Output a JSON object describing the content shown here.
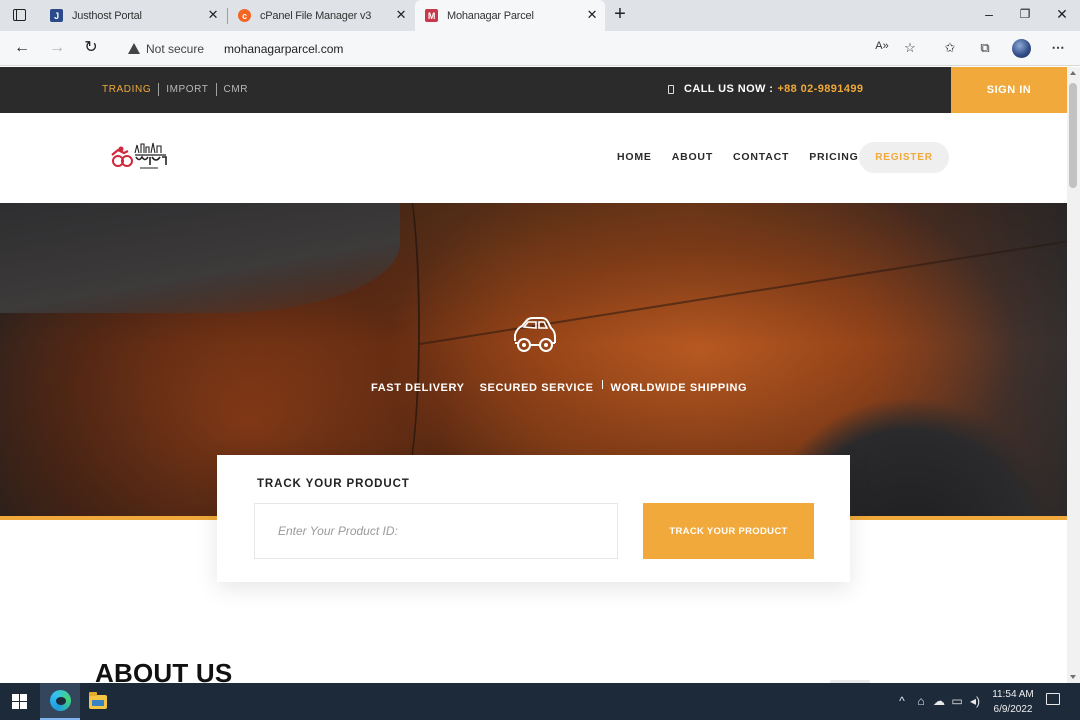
{
  "browser": {
    "tabs": [
      {
        "title": "Justhost Portal",
        "favicon": "justhost-icon"
      },
      {
        "title": "cPanel File Manager v3",
        "favicon": "cpanel-icon"
      },
      {
        "title": "Mohanagar Parcel",
        "favicon": "site-favicon-icon"
      }
    ],
    "address": {
      "security_label": "Not secure",
      "url": "mohanagarparcel.com"
    }
  },
  "site": {
    "topbar": {
      "links": [
        "TRADING",
        "IMPORT",
        "CMR"
      ],
      "call_label": "CALL US NOW :",
      "phone": "+88 02-9891499",
      "signin": "SIGN IN"
    },
    "nav": {
      "links": [
        "HOME",
        "ABOUT",
        "CONTACT",
        "PRICING"
      ],
      "register": "REGISTER"
    },
    "hero": {
      "features": [
        "FAST DELIVERY",
        "SECURED SERVICE",
        "WORLDWIDE SHIPPING"
      ]
    },
    "tracker": {
      "title": "TRACK YOUR PRODUCT",
      "placeholder": "Enter Your Product ID:",
      "button": "TRACK YOUR PRODUCT"
    },
    "about": {
      "heading": "ABOUT US"
    }
  },
  "taskbar": {
    "time": "11:54 AM",
    "date": "6/9/2022"
  },
  "colors": {
    "accent": "#f0a93a",
    "topbar_bg": "#2b2b2b",
    "taskbar_bg": "#1d2a3a"
  }
}
